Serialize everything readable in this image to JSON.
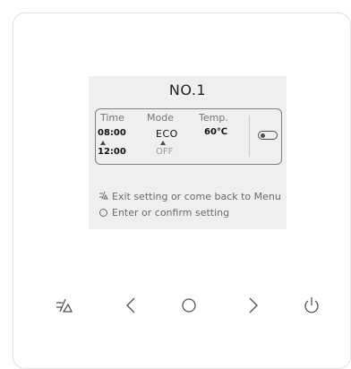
{
  "screen": {
    "title": "NO.1",
    "columns": {
      "time": "Time",
      "mode": "Mode",
      "temp": "Temp."
    },
    "time_start": "08:00",
    "time_end": "12:00",
    "mode_value": "ECO",
    "mode_off": "OFF",
    "temp_value": "60℃",
    "toggle_state": "off"
  },
  "legend": {
    "back": "Exit setting or come back to Menu",
    "confirm": "Enter or confirm setting"
  },
  "buttons": [
    "back-icon",
    "chevron-left-icon",
    "circle-icon",
    "chevron-right-icon",
    "power-icon"
  ]
}
